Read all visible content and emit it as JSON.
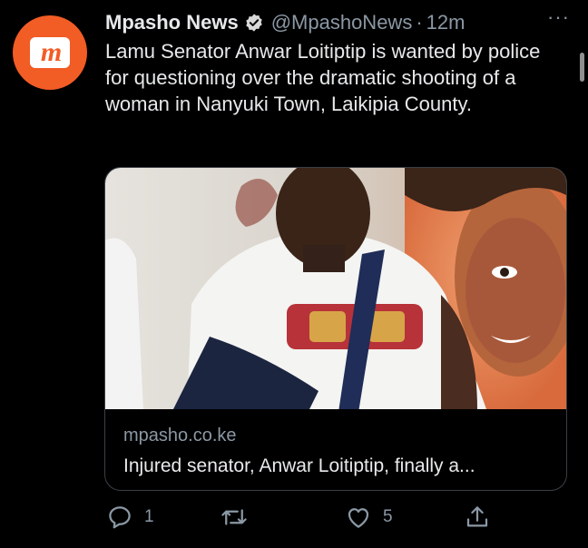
{
  "account": {
    "display_name": "Mpasho News",
    "handle": "@MpashoNews",
    "separator": "·",
    "time": "12m",
    "avatar_letter": "m",
    "more_label": "···"
  },
  "tweet": {
    "text": "Lamu Senator Anwar Loitiptip is wanted by police for questioning over the dramatic shooting of a woman in Nanyuki Town, Laikipia County."
  },
  "link_card": {
    "domain": "mpasho.co.ke",
    "title": "Injured senator, Anwar Loitiptip, finally a..."
  },
  "actions": {
    "reply_count": "1",
    "retweet_count": "",
    "like_count": "5"
  },
  "colors": {
    "background": "#000000",
    "brand": "#f25c25",
    "verified": "#d9d9d9",
    "muted_text": "#8b98a5"
  },
  "icons": [
    "verified-badge-icon",
    "more-icon",
    "reply-icon",
    "retweet-icon",
    "like-icon",
    "share-icon"
  ]
}
